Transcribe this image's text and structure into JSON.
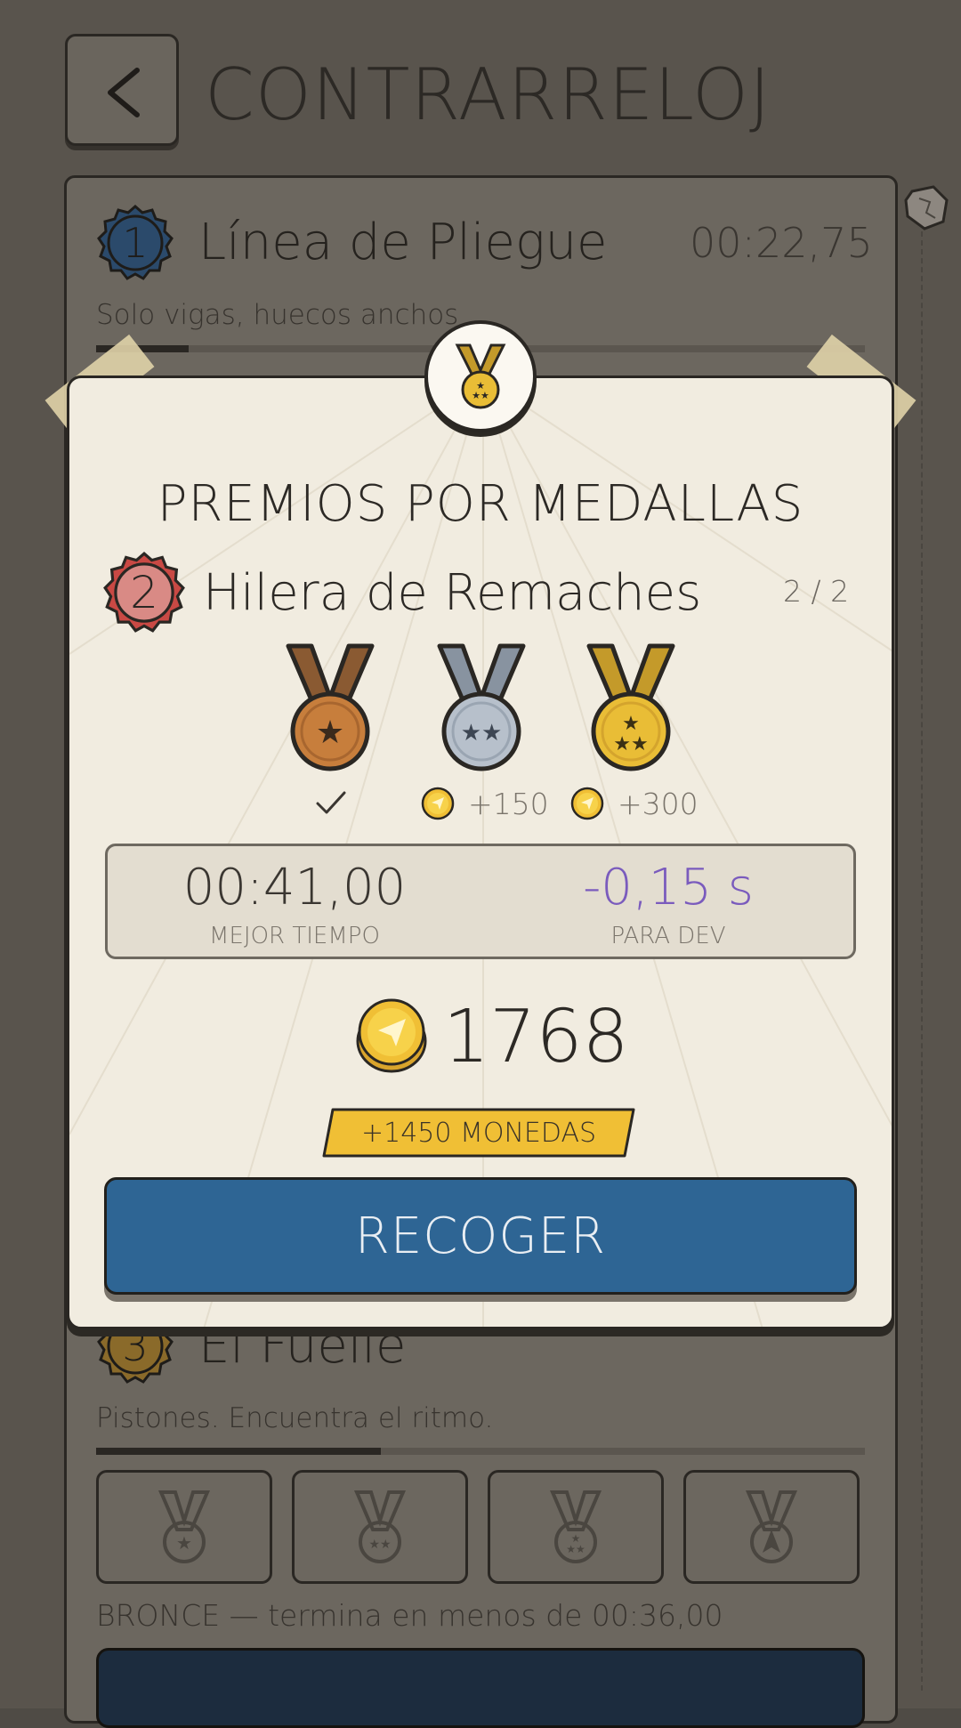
{
  "header": {
    "title": "CONTRARRELOJ"
  },
  "levels": [
    {
      "number": "1",
      "name": "Línea de Pliegue",
      "best_time": "00:22,75",
      "description": "Solo vigas, huecos anchos",
      "badge_color": "#2b4a6b",
      "progress": 0.12
    },
    {
      "number": "3",
      "name": "El Fuelle",
      "description": "Pistones. Encuentra el ritmo.",
      "badge_color": "#8a6a2a",
      "progress": 0.37,
      "hint": "BRONCE — termina en menos de 00:36,00"
    }
  ],
  "modal": {
    "title": "PREMIOS POR MEDALLAS",
    "level_number": "2",
    "level_name": "Hilera de Remaches",
    "level_badge_color": "#c94944",
    "medal_count": "2 / 2",
    "medals": [
      {
        "name": "bronze",
        "color": "#c77e3c",
        "ribbon": "#8a5a32",
        "reward": "",
        "claimed": true
      },
      {
        "name": "silver",
        "color": "#b7c0cb",
        "ribbon": "#8893a0",
        "reward": "+150",
        "claimed": false
      },
      {
        "name": "gold",
        "color": "#e9bd36",
        "ribbon": "#c49a2a",
        "reward": "+300",
        "claimed": false
      }
    ],
    "best_time_value": "00:41,00",
    "best_time_label": "MEJOR TIEMPO",
    "dev_delta_value": "-0,15 s",
    "dev_delta_label": "PARA DEV",
    "dev_delta_color": "#7a5bbd",
    "coin_total": "1768",
    "bonus_label": "+1450 MONEDAS",
    "collect_label": "RECOGER",
    "accent_blue": "#2e6594",
    "coin_color": "#f0bf35"
  }
}
